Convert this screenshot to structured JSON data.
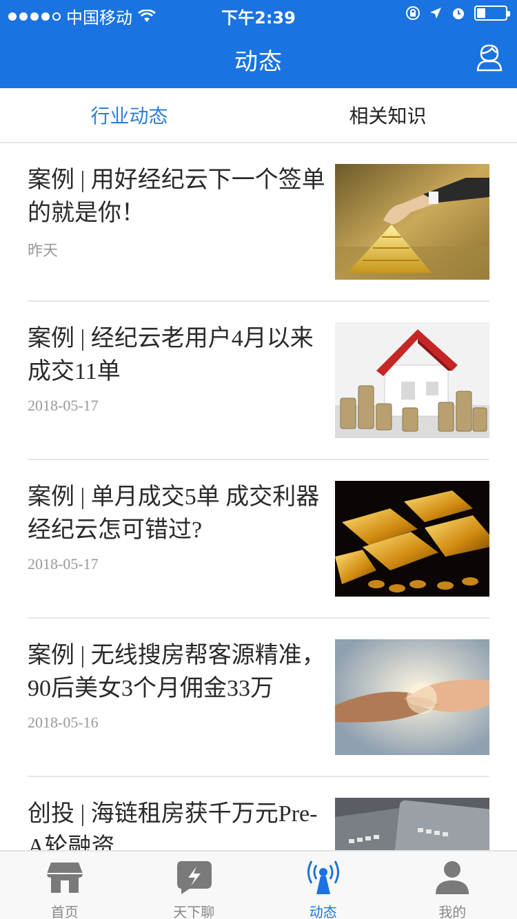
{
  "status": {
    "carrier": "中国移动",
    "time": "下午2:39",
    "battery_level": 0.3
  },
  "header": {
    "title": "动态",
    "user_icon": "user-icon"
  },
  "tabs": [
    {
      "label": "行业动态",
      "active": true
    },
    {
      "label": "相关知识",
      "active": false
    }
  ],
  "articles": [
    {
      "title": "案例 | 用好经纪云下一个签单的就是你！",
      "date": "昨天",
      "thumb": "gold-pyramid-image"
    },
    {
      "title": "案例 | 经纪云老用户4月以来成交11单",
      "date": "2018-05-17",
      "thumb": "house-coins-image"
    },
    {
      "title": "案例 | 单月成交5单 成交利器经纪云怎可错过?",
      "date": "2018-05-17",
      "thumb": "gold-bars-image"
    },
    {
      "title": "案例 | 无线搜房帮客源精准，90后美女3个月佣金33万",
      "date": "2018-05-16",
      "thumb": "handshake-image"
    },
    {
      "title": "创投 | 海链租房获千万元Pre-A轮融资",
      "date": "",
      "thumb": "credit-cards-image"
    }
  ],
  "tabbar": [
    {
      "label": "首页",
      "icon": "home-icon",
      "active": false
    },
    {
      "label": "天下聊",
      "icon": "chat-bolt-icon",
      "active": false
    },
    {
      "label": "动态",
      "icon": "broadcast-icon",
      "active": true
    },
    {
      "label": "我的",
      "icon": "profile-icon",
      "active": false
    }
  ],
  "colors": {
    "brand": "#1a73e0",
    "tab_active": "#2d7fd8",
    "date": "#999999"
  }
}
